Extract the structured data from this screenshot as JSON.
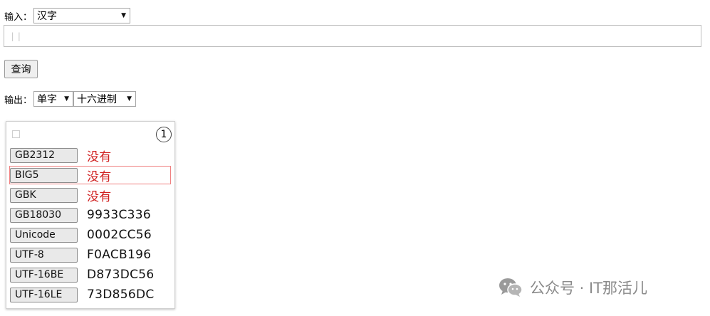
{
  "input": {
    "label": "输入：",
    "encoding_select": "汉字",
    "text_cursor": "||"
  },
  "query_button": "查询",
  "output": {
    "label": "输出：",
    "mode_select": "单字",
    "radix_select": "十六进制"
  },
  "result_card": {
    "index": "1",
    "rows": [
      {
        "encoding": "GB2312",
        "value": "没有",
        "missing": true
      },
      {
        "encoding": "BIG5",
        "value": "没有",
        "missing": true
      },
      {
        "encoding": "GBK",
        "value": "没有",
        "missing": true
      },
      {
        "encoding": "GB18030",
        "value": "9933C336",
        "missing": false
      },
      {
        "encoding": "Unicode",
        "value": "0002CC56",
        "missing": false
      },
      {
        "encoding": "UTF-8",
        "value": "F0ACB196",
        "missing": false
      },
      {
        "encoding": "UTF-16BE",
        "value": "D873DC56",
        "missing": false
      },
      {
        "encoding": "UTF-16LE",
        "value": "73D856DC",
        "missing": false
      }
    ]
  },
  "watermark": {
    "text": "公众号 · IT那活儿",
    "icon": "wechat-icon"
  },
  "colors": {
    "missing_text": "#d02020",
    "highlight_border": "#ef8080",
    "watermark": "#8a8a8a"
  }
}
